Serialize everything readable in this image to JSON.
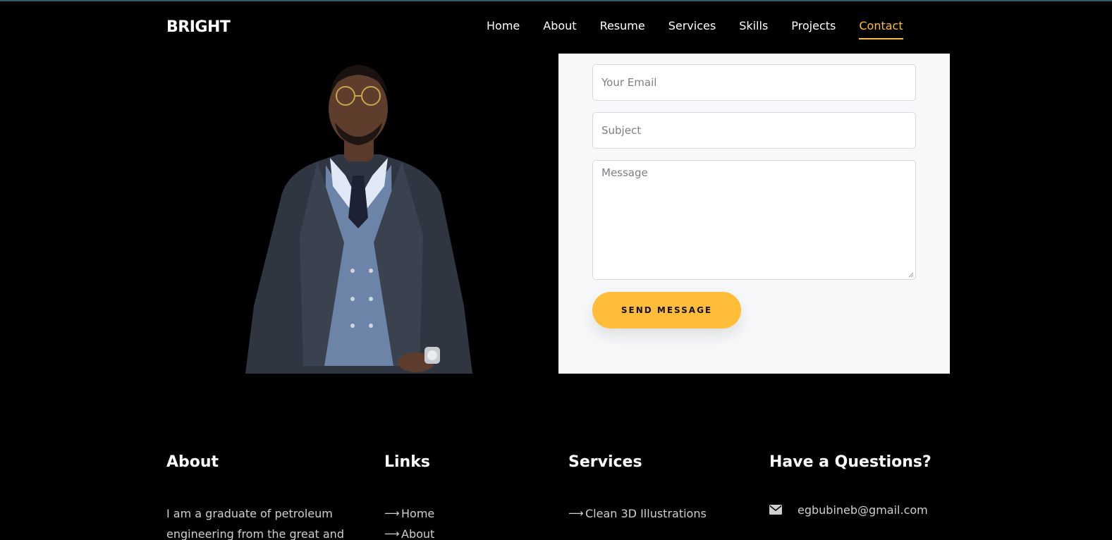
{
  "brand": "BRIGHT",
  "nav": [
    {
      "label": "Home"
    },
    {
      "label": "About"
    },
    {
      "label": "Resume"
    },
    {
      "label": "Services"
    },
    {
      "label": "Skills"
    },
    {
      "label": "Projects"
    },
    {
      "label": "Contact",
      "active": true
    }
  ],
  "contact_form": {
    "email_placeholder": "Your Email",
    "subject_placeholder": "Subject",
    "message_placeholder": "Message",
    "send_label": "SEND MESSAGE"
  },
  "footer": {
    "about": {
      "title": "About",
      "text": "I am a graduate of petroleum engineering from the great and"
    },
    "links": {
      "title": "Links",
      "items": [
        "Home",
        "About"
      ]
    },
    "services": {
      "title": "Services",
      "items": [
        "Clean 3D Illustrations"
      ]
    },
    "question": {
      "title": "Have a Questions?",
      "email": "egbubineb@gmail.com"
    }
  },
  "colors": {
    "accent": "#ffbd39",
    "background": "#000000",
    "card": "#f7f8fa"
  },
  "icons": {
    "link_arrow": "arrow-right-icon",
    "contact_email": "envelope-icon"
  }
}
